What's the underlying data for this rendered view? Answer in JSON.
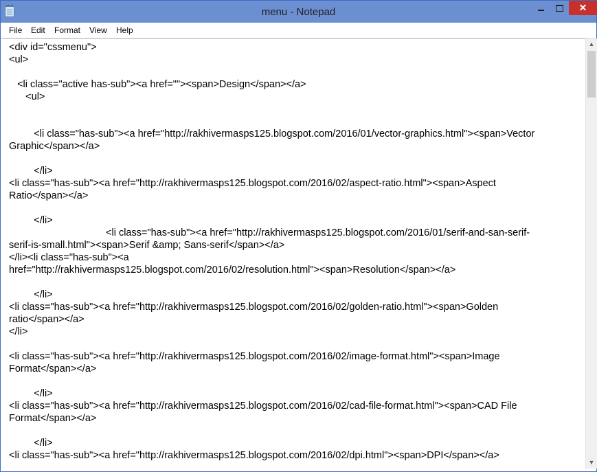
{
  "window": {
    "title": "menu - Notepad",
    "close_glyph": "✕"
  },
  "menu": [
    "File",
    "Edit",
    "Format",
    "View",
    "Help"
  ],
  "lines": [
    "<div id=\"cssmenu\">",
    "<ul>",
    "   <li class=\"active has-sub\"><a href=\"\"><span>Design</span></a>",
    "      <ul>",
    "         <li class=\"has-sub\"><a href=\"http://rakhivermasps125.blogspot.com/2016/01/vector-graphics.html\"><span>Vector",
    "Graphic</span></a>",
    "         </li>",
    "<li class=\"has-sub\"><a href=\"http://rakhivermasps125.blogspot.com/2016/02/aspect-ratio.html\"><span>Aspect",
    "Ratio</span></a>",
    "         </li>",
    "                                   <li class=\"has-sub\"><a href=\"http://rakhivermasps125.blogspot.com/2016/01/serif-and-san-serif-",
    "serif-is-small.html\"><span>Serif &amp; Sans-serif</span></a>",
    "</li><li class=\"has-sub\"><a",
    "href=\"http://rakhivermasps125.blogspot.com/2016/02/resolution.html\"><span>Resolution</span></a>",
    "         </li>",
    "<li class=\"has-sub\"><a href=\"http://rakhivermasps125.blogspot.com/2016/02/golden-ratio.html\"><span>Golden",
    "ratio</span></a>",
    "</li>",
    "<li class=\"has-sub\"><a href=\"http://rakhivermasps125.blogspot.com/2016/02/image-format.html\"><span>Image",
    "Format</span></a>",
    "         </li>",
    "<li class=\"has-sub\"><a href=\"http://rakhivermasps125.blogspot.com/2016/02/cad-file-format.html\"><span>CAD File",
    "Format</span></a>",
    "         </li>",
    "<li class=\"has-sub\"><a href=\"http://rakhivermasps125.blogspot.com/2016/02/dpi.html\"><span>DPI</span></a>"
  ]
}
